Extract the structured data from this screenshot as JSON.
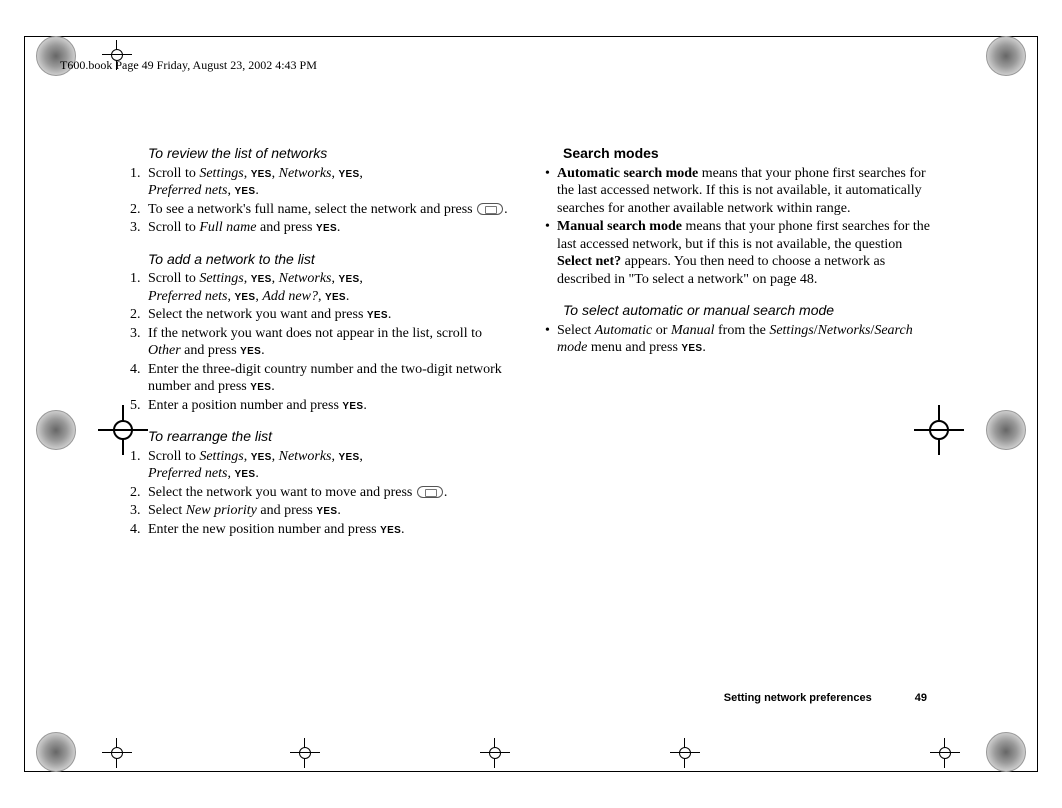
{
  "header": "T600.book  Page 49  Friday, August 23, 2002  4:43 PM",
  "footer": {
    "section": "Setting network preferences",
    "page": "49"
  },
  "yes": "YES",
  "left": {
    "review": {
      "title": "To review the list of networks",
      "s1a": "Scroll to ",
      "s1b": "Settings",
      "s1c": ", ",
      "s1d": ", ",
      "s1e": "Networks",
      "s1f": ", ",
      "s1g": ", ",
      "s1h": "Preferred nets",
      "s1i": ", ",
      "s1j": ".",
      "s2a": "To see a network's full name, select the network and press ",
      "s2b": ".",
      "s3a": "Scroll to ",
      "s3b": "Full name",
      "s3c": " and press ",
      "s3d": "."
    },
    "add": {
      "title": "To add a network to the list",
      "s1a": "Scroll to ",
      "s1b": "Settings",
      "s1c": ", ",
      "s1d": ", ",
      "s1e": "Networks",
      "s1f": ", ",
      "s1g": ", ",
      "s1h": "Preferred nets",
      "s1i": ", ",
      "s1j": ", ",
      "s1k": "Add new?",
      "s1l": ", ",
      "s1m": ".",
      "s2a": "Select the network you want and press ",
      "s2b": ".",
      "s3a": "If the network you want does not appear in the list, scroll to ",
      "s3b": "Other",
      "s3c": " and press ",
      "s3d": ".",
      "s4a": "Enter the three-digit country number and the two-digit network number and press ",
      "s4b": ".",
      "s5a": "Enter a position number and press ",
      "s5b": "."
    },
    "rearr": {
      "title": "To rearrange the list",
      "s1a": "Scroll to ",
      "s1b": "Settings",
      "s1c": ", ",
      "s1d": ", ",
      "s1e": "Networks",
      "s1f": ", ",
      "s1g": ", ",
      "s1h": "Preferred nets",
      "s1i": ", ",
      "s1j": ".",
      "s2a": "Select the network you want to move and press ",
      "s2b": ".",
      "s3a": "Select ",
      "s3b": "New priority",
      "s3c": " and press ",
      "s3d": ".",
      "s4a": "Enter the new position number and press ",
      "s4b": "."
    }
  },
  "right": {
    "search": {
      "title": "Search modes",
      "b1a": "Automatic search mode",
      "b1b": " means that your phone first searches for the last accessed network. If this is not available, it automatically searches for another available network within range.",
      "b2a": "Manual search mode",
      "b2b": " means that your phone first searches for the last accessed network, but if this is not available, the question ",
      "b2c": "Select net?",
      "b2d": " appears. You then need to choose a network as described in \"To select a network\" on page 48."
    },
    "select": {
      "title": "To select automatic or manual search mode",
      "b1a": "Select ",
      "b1b": "Automatic",
      "b1c": " or ",
      "b1d": "Manual",
      "b1e": " from the ",
      "b1f": "Settings",
      "b1g": "/",
      "b1h": "Networks",
      "b1i": "/",
      "b1j": "Search mode",
      "b1k": " menu and press ",
      "b1l": "."
    }
  }
}
